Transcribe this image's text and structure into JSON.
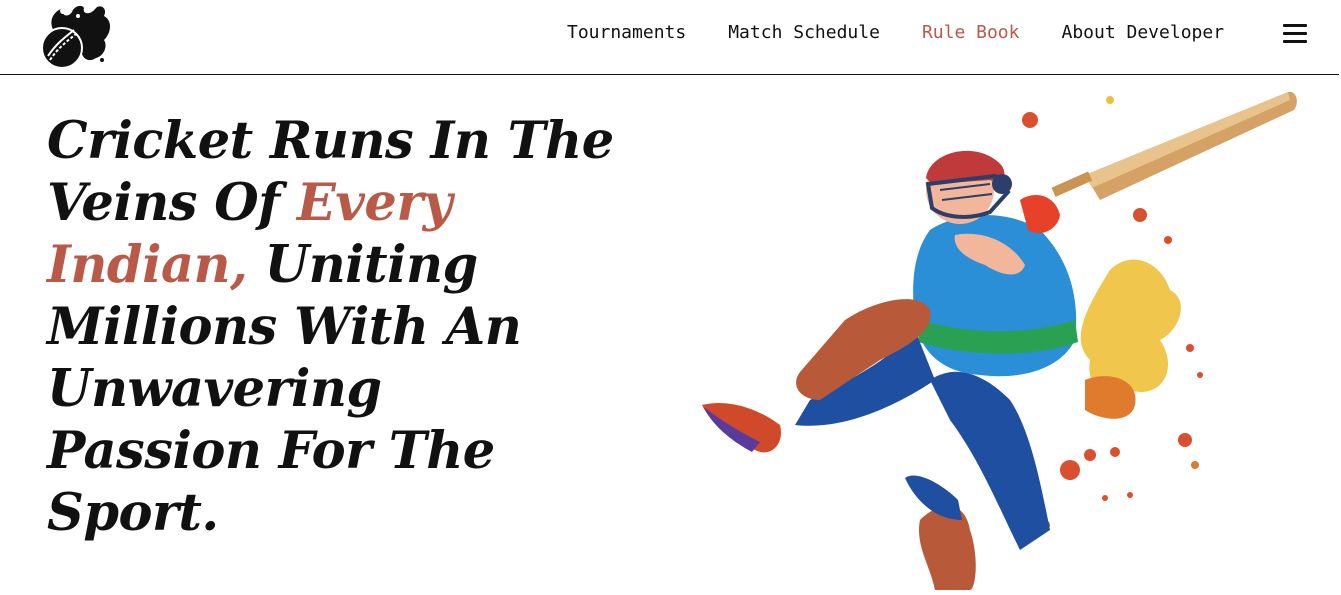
{
  "nav": {
    "links": [
      {
        "label": "Tournaments",
        "active": false
      },
      {
        "label": "Match Schedule",
        "active": false
      },
      {
        "label": "Rule Book",
        "active": true
      },
      {
        "label": "About Developer",
        "active": false
      }
    ],
    "logo_icon": "cricket-ball-flame-logo",
    "menu_icon": "hamburger-menu-icon"
  },
  "hero": {
    "heading": {
      "l1": "Cricket Runs In The",
      "l2_pre": "Veins Of ",
      "l2_accent": "Every",
      "l3_accent": "Indian,",
      "l3_post": " Uniting",
      "l4": "Millions With An",
      "l5": "Unwavering",
      "l6": "Passion For The",
      "l7": "Sport."
    },
    "illustration": "cricket-batsman-illustration"
  },
  "colors": {
    "accent": "#b95a48",
    "text": "#111111",
    "background": "#ffffff"
  }
}
